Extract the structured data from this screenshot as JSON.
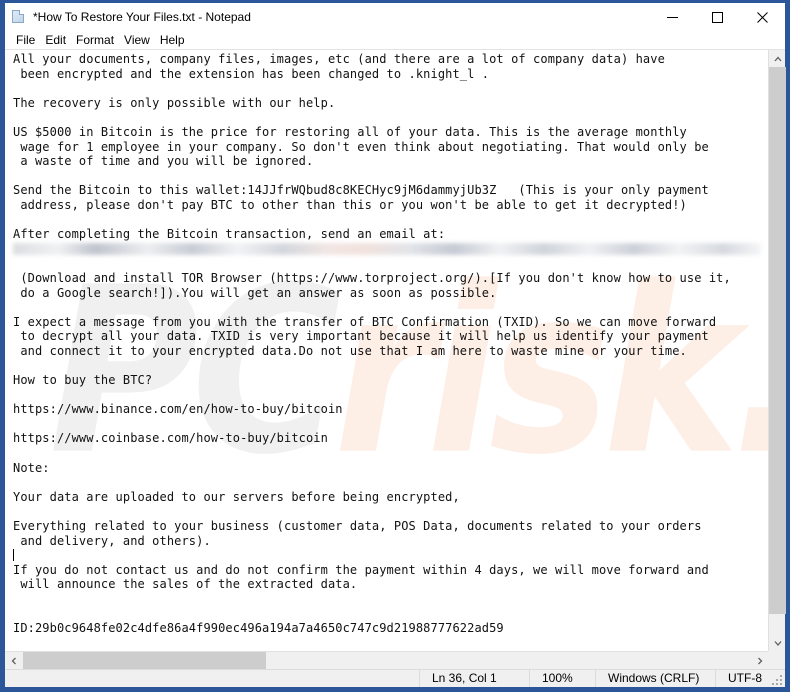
{
  "window": {
    "title": "*How To Restore Your Files.txt - Notepad",
    "app_icon": "notepad-document-icon",
    "controls": {
      "minimize": "minimize-icon",
      "maximize": "maximize-icon",
      "close": "close-icon"
    }
  },
  "menubar": {
    "items": [
      {
        "label": "File"
      },
      {
        "label": "Edit"
      },
      {
        "label": "Format"
      },
      {
        "label": "View"
      },
      {
        "label": "Help"
      }
    ]
  },
  "document": {
    "lines": [
      "All your documents, company files, images, etc (and there are a lot of company data) have",
      " been encrypted and the extension has been changed to .knight_l .",
      "",
      "The recovery is only possible with our help.",
      "",
      "US $5000 in Bitcoin is the price for restoring all of your data. This is the average monthly",
      " wage for 1 employee in your company. So don't even think about negotiating. That would only be",
      " a waste of time and you will be ignored.",
      "",
      "Send the Bitcoin to this wallet:14JJfrWQbud8c8KECHyc9jM6dammyjUb3Z   (This is your only payment",
      " address, please don't pay BTC to other than this or you won't be able to get it decrypted!)",
      "",
      "After completing the Bitcoin transaction, send an email at:",
      "[REDACTED]",
      "",
      " (Download and install TOR Browser (https://www.torproject.org/).[If you don't know how to use it,",
      " do a Google search!]).You will get an answer as soon as possible.",
      "",
      "I expect a message from you with the transfer of BTC Confirmation (TXID). So we can move forward",
      " to decrypt all your data. TXID is very important because it will help us identify your payment",
      " and connect it to your encrypted data.Do not use that I am here to waste mine or your time.",
      "",
      "How to buy the BTC?",
      "",
      "https://www.binance.com/en/how-to-buy/bitcoin",
      "",
      "https://www.coinbase.com/how-to-buy/bitcoin",
      "",
      "Note:",
      "",
      "Your data are uploaded to our servers before being encrypted,",
      "",
      "Everything related to your business (customer data, POS Data, documents related to your orders",
      " and delivery, and others).",
      "",
      "If you do not contact us and do not confirm the payment within 4 days, we will move forward and",
      " will announce the sales of the extracted data.",
      "",
      "",
      "ID:29b0c9648fe02c4dfe86a4f990ec496a194a7a4650c747c9d21988777622ad59"
    ],
    "redacted_line_index": 13,
    "caret_line_index": 34,
    "wallet_address": "14JJfrWQbud8c8KECHyc9jM6dammyjUb3Z",
    "victim_id": "29b0c9648fe02c4dfe86a4f990ec496a194a7a4650c747c9d21988777622ad59",
    "ransom_amount": "US $5000",
    "file_extension": ".knight_l",
    "deadline": "4 days"
  },
  "watermark": {
    "part1": "PC",
    "part2": "risk.com",
    "color1": "#f0f0f0",
    "color2": "#fdeee6"
  },
  "scrollbars": {
    "vertical": {
      "up_icon": "chevron-up-icon",
      "down_icon": "chevron-down-icon"
    },
    "horizontal": {
      "left_icon": "chevron-left-icon",
      "right_icon": "chevron-right-icon"
    }
  },
  "statusbar": {
    "position": "Ln 36, Col 1",
    "zoom": "100%",
    "line_endings": "Windows (CRLF)",
    "encoding": "UTF-8",
    "grip": "resize-grip-icon"
  },
  "colors": {
    "window_border": "#2b579a",
    "scroll_thumb": "#cdcdcd",
    "status_bg": "#f0f0f0"
  }
}
